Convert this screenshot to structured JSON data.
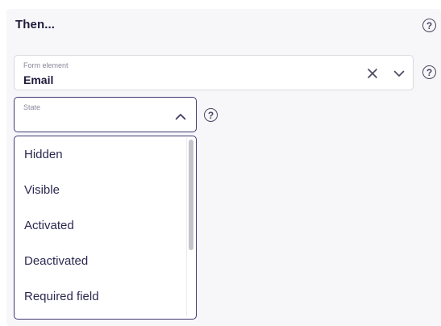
{
  "section": {
    "title": "Then...",
    "help_glyph": "?"
  },
  "form_element": {
    "label": "Form element",
    "value": "Email",
    "clear_icon": "close-icon",
    "expand_icon": "chevron-down-icon"
  },
  "state": {
    "label": "State",
    "value": "",
    "expanded": true,
    "collapse_icon": "chevron-up-icon"
  },
  "state_options": [
    "Hidden",
    "Visible",
    "Activated",
    "Deactivated",
    "Required field"
  ],
  "colors": {
    "accent": "#3e3a72",
    "text": "#1e1b3a",
    "panel": "#f7f7fa"
  }
}
